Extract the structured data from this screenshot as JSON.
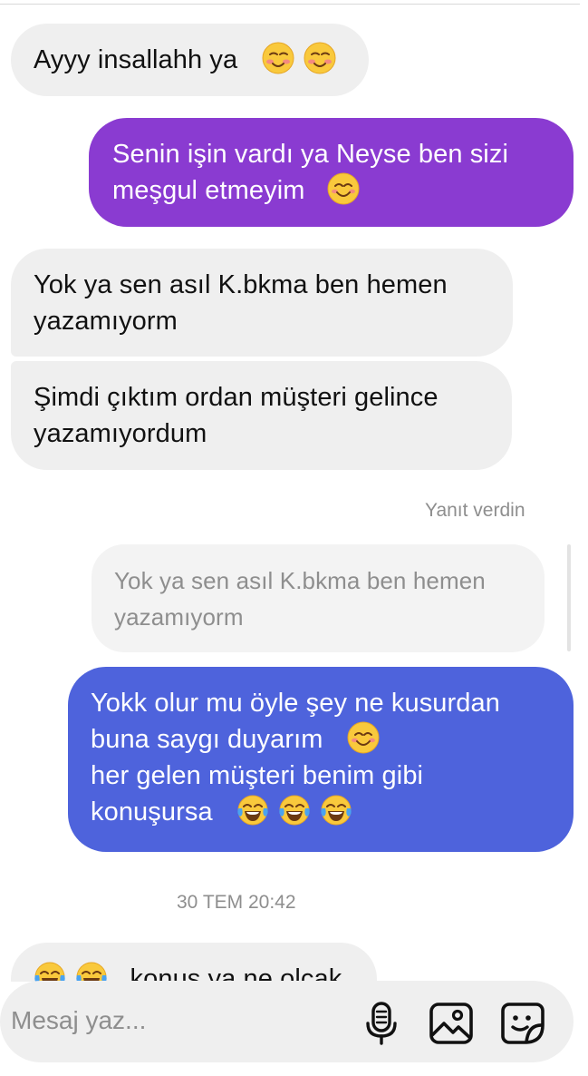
{
  "messages": [
    {
      "id": "m1",
      "direction": "in",
      "lines": [
        "Ayyy insallahh ya"
      ],
      "trailing_emojis": [
        "smiling-blush",
        "smiling-blush"
      ]
    },
    {
      "id": "m2",
      "direction": "out",
      "lines": [
        "Senin işin vardı ya Neyse ben sizi",
        "meşgul etmeyim"
      ],
      "trailing_emojis": [
        "smiling-eyes"
      ],
      "bubble_color": "#8a3bd1"
    },
    {
      "id": "m3",
      "direction": "in",
      "lines": [
        "Yok ya sen asıl K.bkma ben hemen",
        "yazamıyorm"
      ]
    },
    {
      "id": "m4",
      "direction": "in",
      "lines": [
        "Şimdi çıktım ordan müşteri gelince",
        "yazamıyordum"
      ]
    },
    {
      "id": "m5",
      "direction": "out",
      "lines": [
        "Yokk olur mu öyle şey ne kusurdan",
        "buna saygı duyarım",
        "her  gelen müşteri benim gibi",
        "konuşursa"
      ],
      "bubble_color": "#4e63dc"
    },
    {
      "id": "m6",
      "direction": "in",
      "lines": [
        "konus ya ne olcak"
      ]
    }
  ],
  "reply_label": "Yanıt verdin",
  "reply_quote": {
    "lines": [
      "Yok ya sen asıl K.bkma ben hemen",
      "yazamıyorm"
    ]
  },
  "timestamp": "30 TEM 20:42",
  "composer": {
    "placeholder": "Mesaj yaz...",
    "icons": [
      "microphone-icon",
      "gallery-icon",
      "sticker-icon"
    ]
  },
  "colors": {
    "incoming_bubble": "#efefef",
    "outgoing_purple": "#8a3bd1",
    "outgoing_blue": "#4e63dc",
    "meta_text": "#8e8e8e"
  }
}
